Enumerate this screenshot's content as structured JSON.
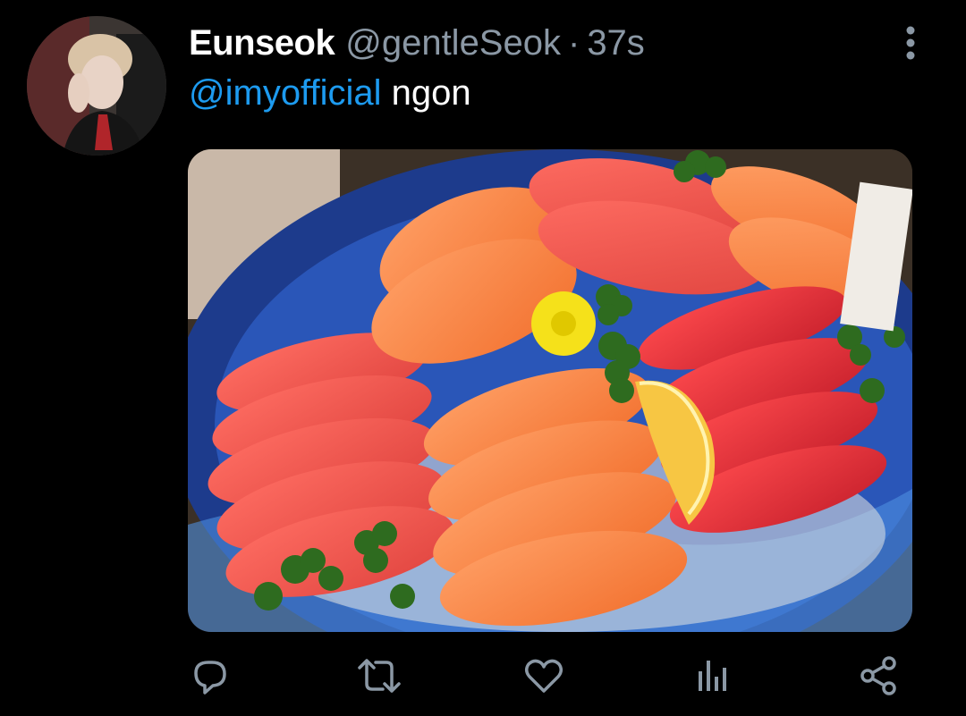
{
  "tweet": {
    "author": {
      "name": "Eunseok",
      "handle": "@gentleSeok",
      "separator": "·",
      "time": "37s"
    },
    "text": {
      "mention": "@imyofficial",
      "body": "ngon"
    },
    "media": {
      "description_icon": "photo-icon"
    },
    "colors": {
      "background": "#000000",
      "secondary_text": "#8b98a5",
      "link": "#1d9bf0",
      "icon": "#8b98a5"
    },
    "actions": [
      {
        "icon": "reply-icon"
      },
      {
        "icon": "retweet-icon"
      },
      {
        "icon": "like-icon"
      },
      {
        "icon": "analytics-icon"
      },
      {
        "icon": "share-icon"
      }
    ]
  }
}
